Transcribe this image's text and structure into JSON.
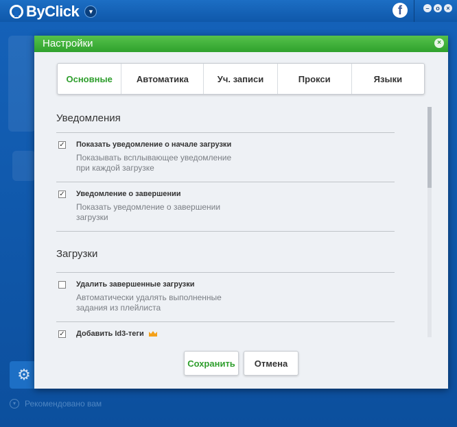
{
  "app": {
    "title": "ByClick",
    "recommended": "Рекомендовано вам",
    "colors": {
      "accent_blue": "#1461b8",
      "green": "#2fa12d"
    }
  },
  "dialog": {
    "title": "Настройки",
    "tabs": [
      {
        "label": "Основные",
        "active": true
      },
      {
        "label": "Автоматика",
        "active": false
      },
      {
        "label": "Уч. записи",
        "active": false
      },
      {
        "label": "Прокси",
        "active": false
      },
      {
        "label": "Языки",
        "active": false
      }
    ],
    "sections": {
      "notifications": {
        "title": "Уведомления",
        "options": [
          {
            "title": "Показать уведомление о начале загрузки",
            "desc": "Показывать всплывающее уведомление при каждой загрузке",
            "checked": true
          },
          {
            "title": "Уведомление о завершении",
            "desc": "Показать уведомление о завершении загрузки",
            "checked": true
          }
        ]
      },
      "downloads": {
        "title": "Загрузки",
        "options": [
          {
            "title": "Удалить завершенные загрузки",
            "desc": "Автоматически удалять выполненные задания из плейлиста",
            "checked": false
          },
          {
            "title": "Добавить Id3-теги",
            "desc": "",
            "checked": true
          }
        ]
      }
    },
    "buttons": {
      "save": "Сохранить",
      "cancel": "Отмена"
    }
  }
}
